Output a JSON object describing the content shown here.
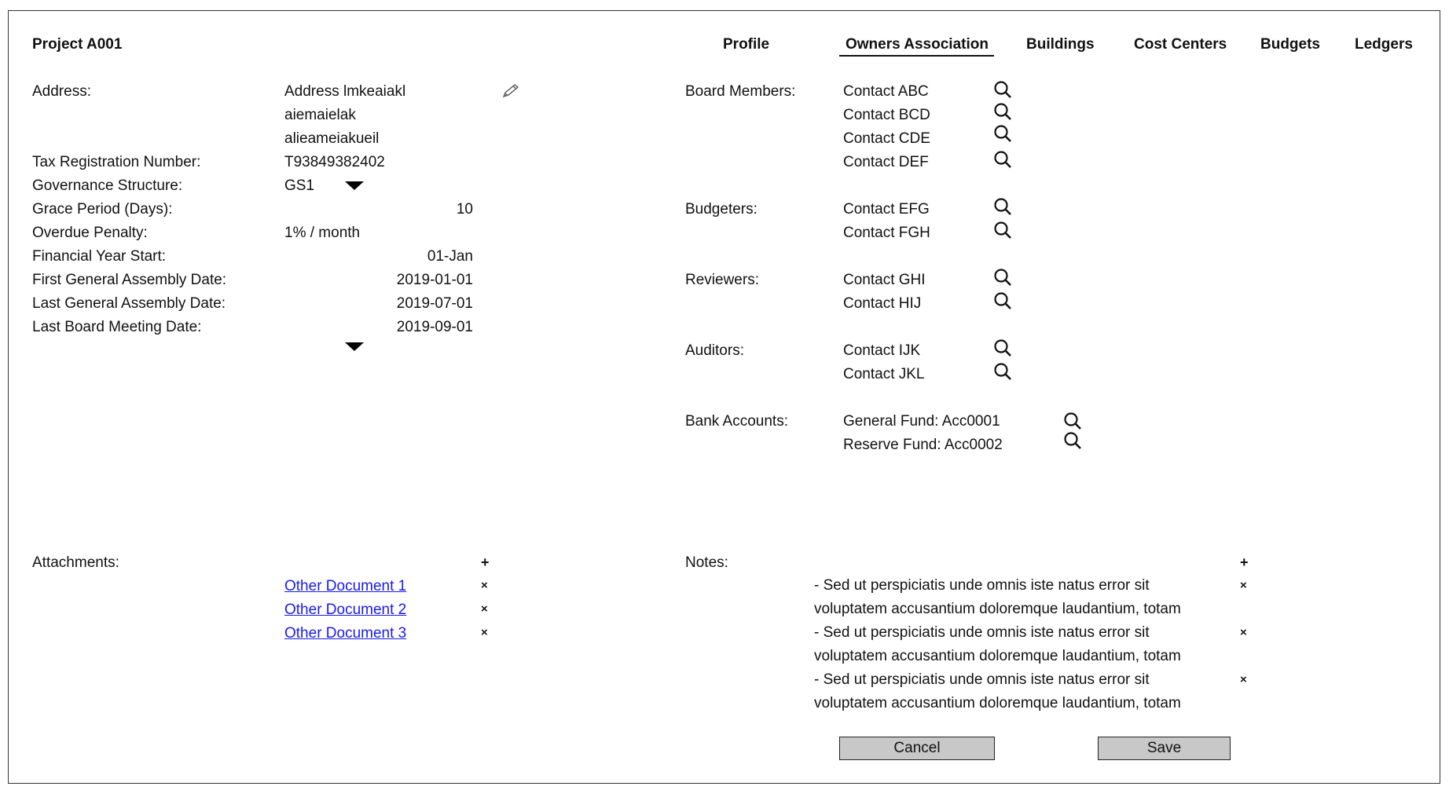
{
  "project": {
    "title": "Project A001"
  },
  "tabs": [
    {
      "label": "Profile"
    },
    {
      "label": "Owners Association"
    },
    {
      "label": "Buildings"
    },
    {
      "label": "Cost Centers"
    },
    {
      "label": "Budgets"
    },
    {
      "label": "Ledgers"
    }
  ],
  "active_tab": "Owners Association",
  "form": {
    "address_label": "Address:",
    "address_lines": [
      "Address lmkeaiakl",
      "aiemaielak",
      "alieameiakueil"
    ],
    "tax_label": "Tax Registration Number:",
    "tax_value": "T93849382402",
    "governance_label": "Governance Structure:",
    "governance_value": "GS1",
    "grace_label": "Grace Period (Days):",
    "grace_value": "10",
    "penalty_label": "Overdue Penalty:",
    "penalty_value": "1% / month",
    "fy_label": "Financial Year Start:",
    "fy_value": "01-Jan",
    "first_ga_label": "First General Assembly Date:",
    "first_ga_value": "2019-01-01",
    "last_ga_label": "Last General Assembly Date:",
    "last_ga_value": "2019-07-01",
    "last_board_label": "Last Board Meeting Date:",
    "last_board_value": "2019-09-01"
  },
  "contacts": {
    "board_label": "Board Members:",
    "board": [
      "Contact ABC",
      "Contact BCD",
      "Contact CDE",
      "Contact DEF"
    ],
    "budgeters_label": "Budgeters:",
    "budgeters": [
      "Contact EFG",
      "Contact FGH"
    ],
    "reviewers_label": "Reviewers:",
    "reviewers": [
      "Contact GHI",
      "Contact HIJ"
    ],
    "auditors_label": "Auditors:",
    "auditors": [
      "Contact IJK",
      "Contact JKL"
    ],
    "bank_label": "Bank Accounts:",
    "bank": [
      "General Fund: Acc0001",
      "Reserve Fund: Acc0002"
    ]
  },
  "attachments": {
    "label": "Attachments:",
    "add_icon": "+",
    "remove_icon": "×",
    "items": [
      "Other Document 1",
      "Other Document 2",
      "Other Document 3"
    ]
  },
  "notes": {
    "label": "Notes:",
    "add_icon": "+",
    "remove_icon": "×",
    "items": [
      {
        "line1": "- Sed ut perspiciatis unde omnis iste natus error sit",
        "line2": "voluptatem accusantium doloremque laudantium, totam"
      },
      {
        "line1": "- Sed ut perspiciatis unde omnis iste natus error sit",
        "line2": "voluptatem accusantium doloremque laudantium, totam"
      },
      {
        "line1": "- Sed ut perspiciatis unde omnis iste natus error sit",
        "line2": "voluptatem accusantium doloremque laudantium, totam"
      }
    ]
  },
  "actions": {
    "cancel_label": "Cancel",
    "save_label": "Save"
  },
  "icons": {
    "edit": "pencil-icon",
    "search": "search-icon",
    "dropdown": "dropdown-triangle-icon",
    "add": "plus-icon",
    "remove": "close-icon"
  }
}
